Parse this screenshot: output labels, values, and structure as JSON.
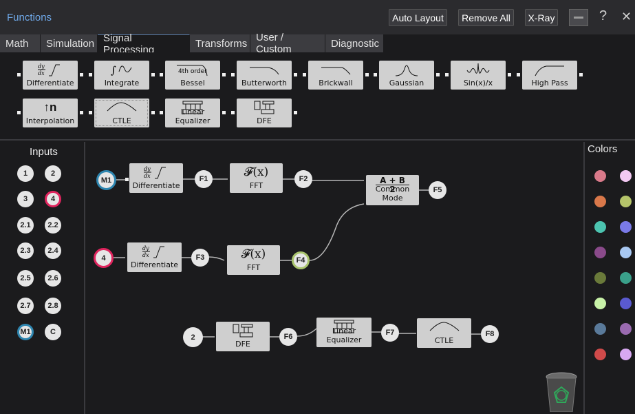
{
  "app": {
    "title": "Functions"
  },
  "toolbar": {
    "auto_layout": "Auto Layout",
    "remove_all": "Remove All",
    "xray": "X-Ray",
    "help_glyph": "?",
    "close_glyph": "✕"
  },
  "tabs": [
    {
      "label": "Math"
    },
    {
      "label": "Simulation"
    },
    {
      "label": "Signal Processing",
      "active": true
    },
    {
      "label": "Transforms"
    },
    {
      "label": "User / Custom"
    },
    {
      "label": "Diagnostic"
    }
  ],
  "palette": [
    {
      "label": "Differentiate",
      "icon": "derivative-icon"
    },
    {
      "label": "Integrate",
      "icon": "integral-icon"
    },
    {
      "label": "Bessel",
      "icon": "bessel-filter-icon",
      "icon_text": "4th order"
    },
    {
      "label": "Butterworth",
      "icon": "butterworth-filter-icon"
    },
    {
      "label": "Brickwall",
      "icon": "brickwall-filter-icon"
    },
    {
      "label": "Gaussian",
      "icon": "gaussian-icon"
    },
    {
      "label": "Sin(x)/x",
      "icon": "sinc-icon"
    },
    {
      "label": "High Pass",
      "icon": "high-pass-icon"
    },
    {
      "label": "Interpolation",
      "icon": "interpolation-icon",
      "icon_text": "↑n"
    },
    {
      "label": "CTLE",
      "icon": "ctle-icon"
    },
    {
      "label": "Linear Equalizer",
      "icon": "linear-equalizer-icon"
    },
    {
      "label": "DFE",
      "icon": "dfe-icon"
    }
  ],
  "inputs": {
    "title": "Inputs",
    "items": [
      "1",
      "2",
      "3",
      "4",
      "2.1",
      "2.2",
      "2.3",
      "2.4",
      "2.5",
      "2.6",
      "2.7",
      "2.8",
      "M1",
      "C"
    ]
  },
  "colors": {
    "title": "Colors",
    "swatches": [
      "#d97a8a",
      "#f2c8f2",
      "#d9784a",
      "#b5c46a",
      "#4cc4b0",
      "#7a7ae8",
      "#8a4a8a",
      "#a8c8f2",
      "#6a7a3a",
      "#3aa08a",
      "#c8f2a8",
      "#5a5ad0",
      "#5a7a9a",
      "#9a6ab0",
      "#d04a4a",
      "#d8a8f2"
    ]
  },
  "canvas": {
    "nodes": {
      "diff1": "Differentiate",
      "fft1": "FFT",
      "fft1_icon": "𝓕(x)",
      "common": "Common Mode",
      "common_num": "A + B",
      "common_den": "2",
      "diff2": "Differentiate",
      "fft2": "FFT",
      "fft2_icon": "𝓕(x)",
      "dfe": "DFE",
      "lineq": "Linear Equalizer",
      "ctle": "CTLE"
    },
    "chips": {
      "m1": "M1",
      "f1": "F1",
      "f2": "F2",
      "f5": "F5",
      "in4": "4",
      "f3": "F3",
      "f4": "F4",
      "in2": "2",
      "f6": "F6",
      "f7": "F7",
      "f8": "F8"
    }
  }
}
